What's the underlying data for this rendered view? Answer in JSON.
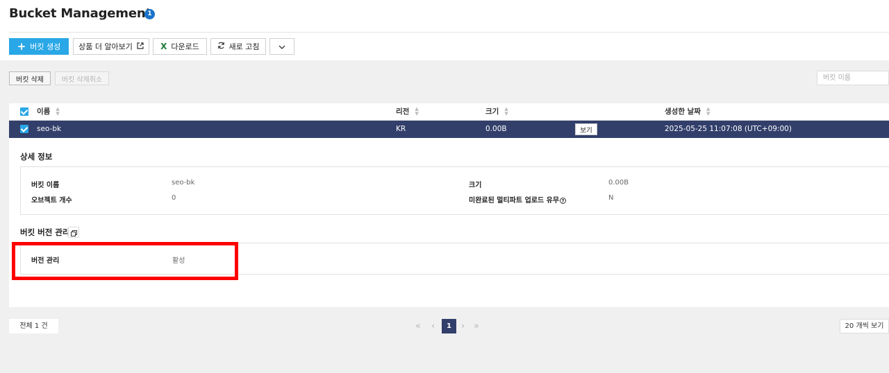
{
  "header": {
    "title": "Bucket Management",
    "badge": "1"
  },
  "toolbar": {
    "create_label": "버킷 생성",
    "learn_more_label": "상품 더 알아보기",
    "download_label": "다운로드",
    "refresh_label": "새로 고침"
  },
  "actions": {
    "delete_label": "버킷 삭제",
    "undo_delete_label": "버킷 삭제취소"
  },
  "search": {
    "placeholder": "버킷 이름"
  },
  "table": {
    "columns": [
      "이름",
      "리전",
      "크기",
      "생성한 날짜"
    ],
    "rows": [
      {
        "name": "seo-bk",
        "region": "KR",
        "size": "0.00B",
        "view_label": "보기",
        "created": "2025-05-25 11:07:08 (UTC+09:00)"
      }
    ]
  },
  "detail": {
    "section_title": "상세 정보",
    "bucket_name_label": "버킷 이름",
    "bucket_name_value": "seo-bk",
    "size_label": "크기",
    "size_value": "0.00B",
    "object_count_label": "오브젝트 개수",
    "object_count_value": "0",
    "multipart_label": "미완료된 멀티파트 업로드 유무",
    "multipart_value": "N"
  },
  "versioning": {
    "section_title": "버킷 버전 관리",
    "label": "버전 관리",
    "value": "활성"
  },
  "footer": {
    "total_label": "전체 1 건",
    "current_page": "1",
    "per_page_label": "20 개씩 보기"
  },
  "colors": {
    "primary": "#29a7e6",
    "selected_row": "#323f6b",
    "highlight": "#ff0000"
  }
}
